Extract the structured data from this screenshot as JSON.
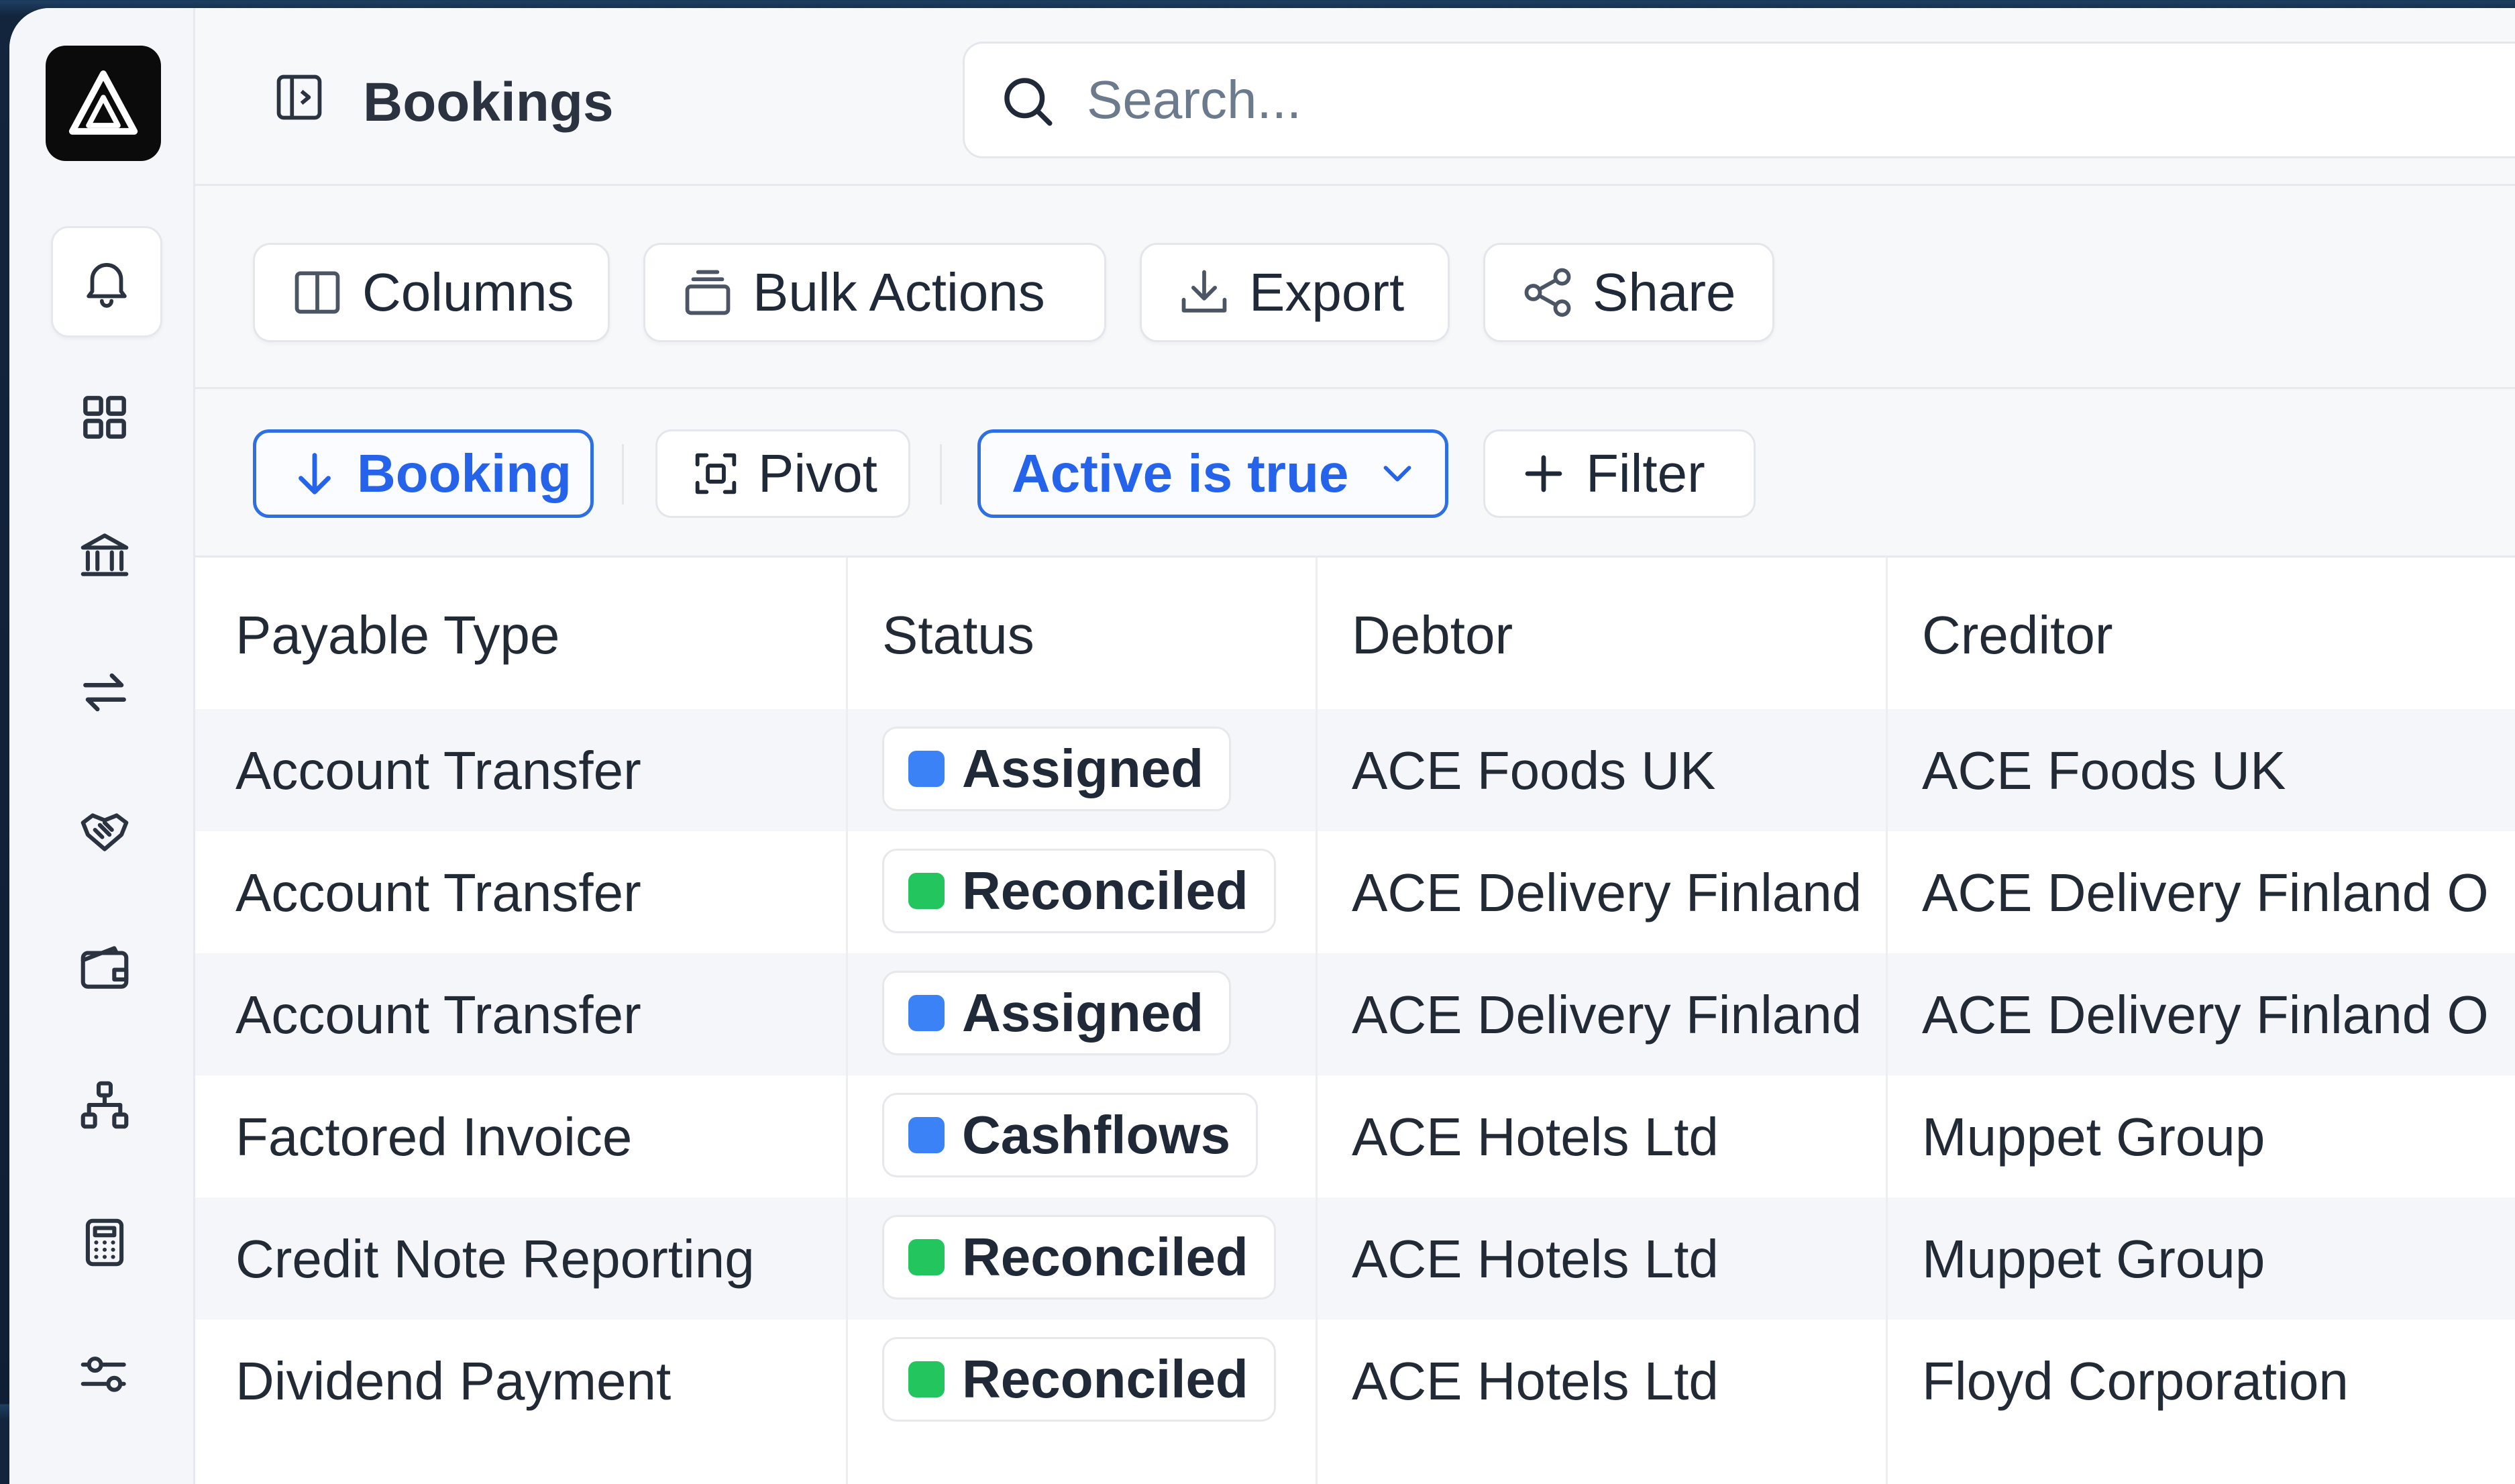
{
  "header": {
    "title": "Bookings",
    "search_placeholder": "Search..."
  },
  "sidebar": {
    "items": [
      {
        "icon": "logo-triangle"
      },
      {
        "icon": "bell-icon",
        "active": true
      },
      {
        "icon": "grid-icon"
      },
      {
        "icon": "bank-icon"
      },
      {
        "icon": "transfer-arrows-icon"
      },
      {
        "icon": "handshake-icon"
      },
      {
        "icon": "wallet-icon"
      },
      {
        "icon": "org-chart-icon"
      },
      {
        "icon": "calculator-icon"
      },
      {
        "icon": "sliders-icon"
      }
    ]
  },
  "toolbar": {
    "columns_label": "Columns",
    "bulk_actions_label": "Bulk Actions",
    "export_label": "Export",
    "share_label": "Share"
  },
  "filters": {
    "sort_label": "Booking",
    "pivot_label": "Pivot",
    "active_filter_label": "Active is true",
    "add_filter_label": "Filter"
  },
  "table": {
    "columns": [
      "Payable Type",
      "Status",
      "Debtor",
      "Creditor"
    ],
    "rows": [
      {
        "payable_type": "Account Transfer",
        "status": "Assigned",
        "status_color": "#3b82f6",
        "debtor": "ACE Foods UK",
        "creditor": "ACE Foods UK"
      },
      {
        "payable_type": "Account Transfer",
        "status": "Reconciled",
        "status_color": "#22c55e",
        "debtor": "ACE Delivery Finland",
        "creditor": "ACE Delivery Finland O"
      },
      {
        "payable_type": "Account Transfer",
        "status": "Assigned",
        "status_color": "#3b82f6",
        "debtor": "ACE Delivery Finland",
        "creditor": "ACE Delivery Finland O"
      },
      {
        "payable_type": "Factored Invoice",
        "status": "Cashflows",
        "status_color": "#3b82f6",
        "debtor": "ACE Hotels Ltd",
        "creditor": "Muppet Group"
      },
      {
        "payable_type": "Credit Note Reporting",
        "status": "Reconciled",
        "status_color": "#22c55e",
        "debtor": "ACE Hotels Ltd",
        "creditor": "Muppet Group"
      },
      {
        "payable_type": "Dividend Payment",
        "status": "Reconciled",
        "status_color": "#22c55e",
        "debtor": "ACE Hotels Ltd",
        "creditor": "Floyd Corporation"
      }
    ]
  },
  "colors": {
    "accent": "#2563eb",
    "assigned": "#3b82f6",
    "reconciled": "#22c55e"
  }
}
